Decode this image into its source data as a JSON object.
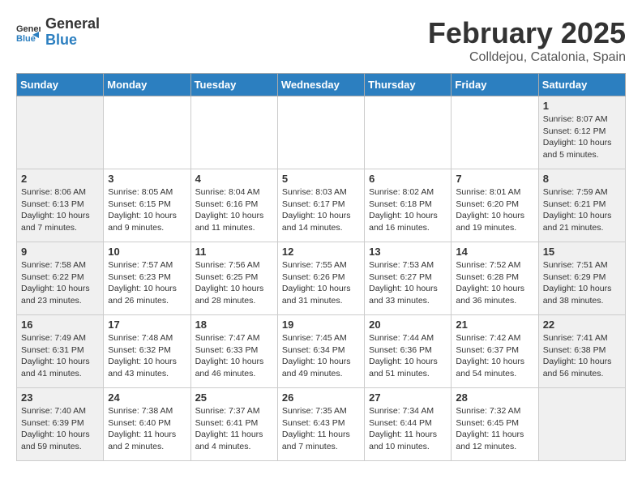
{
  "header": {
    "logo_general": "General",
    "logo_blue": "Blue",
    "month_title": "February 2025",
    "location": "Colldejou, Catalonia, Spain"
  },
  "weekdays": [
    "Sunday",
    "Monday",
    "Tuesday",
    "Wednesday",
    "Thursday",
    "Friday",
    "Saturday"
  ],
  "weeks": [
    [
      {
        "day": "",
        "info": ""
      },
      {
        "day": "",
        "info": ""
      },
      {
        "day": "",
        "info": ""
      },
      {
        "day": "",
        "info": ""
      },
      {
        "day": "",
        "info": ""
      },
      {
        "day": "",
        "info": ""
      },
      {
        "day": "1",
        "info": "Sunrise: 8:07 AM\nSunset: 6:12 PM\nDaylight: 10 hours\nand 5 minutes."
      }
    ],
    [
      {
        "day": "2",
        "info": "Sunrise: 8:06 AM\nSunset: 6:13 PM\nDaylight: 10 hours\nand 7 minutes."
      },
      {
        "day": "3",
        "info": "Sunrise: 8:05 AM\nSunset: 6:15 PM\nDaylight: 10 hours\nand 9 minutes."
      },
      {
        "day": "4",
        "info": "Sunrise: 8:04 AM\nSunset: 6:16 PM\nDaylight: 10 hours\nand 11 minutes."
      },
      {
        "day": "5",
        "info": "Sunrise: 8:03 AM\nSunset: 6:17 PM\nDaylight: 10 hours\nand 14 minutes."
      },
      {
        "day": "6",
        "info": "Sunrise: 8:02 AM\nSunset: 6:18 PM\nDaylight: 10 hours\nand 16 minutes."
      },
      {
        "day": "7",
        "info": "Sunrise: 8:01 AM\nSunset: 6:20 PM\nDaylight: 10 hours\nand 19 minutes."
      },
      {
        "day": "8",
        "info": "Sunrise: 7:59 AM\nSunset: 6:21 PM\nDaylight: 10 hours\nand 21 minutes."
      }
    ],
    [
      {
        "day": "9",
        "info": "Sunrise: 7:58 AM\nSunset: 6:22 PM\nDaylight: 10 hours\nand 23 minutes."
      },
      {
        "day": "10",
        "info": "Sunrise: 7:57 AM\nSunset: 6:23 PM\nDaylight: 10 hours\nand 26 minutes."
      },
      {
        "day": "11",
        "info": "Sunrise: 7:56 AM\nSunset: 6:25 PM\nDaylight: 10 hours\nand 28 minutes."
      },
      {
        "day": "12",
        "info": "Sunrise: 7:55 AM\nSunset: 6:26 PM\nDaylight: 10 hours\nand 31 minutes."
      },
      {
        "day": "13",
        "info": "Sunrise: 7:53 AM\nSunset: 6:27 PM\nDaylight: 10 hours\nand 33 minutes."
      },
      {
        "day": "14",
        "info": "Sunrise: 7:52 AM\nSunset: 6:28 PM\nDaylight: 10 hours\nand 36 minutes."
      },
      {
        "day": "15",
        "info": "Sunrise: 7:51 AM\nSunset: 6:29 PM\nDaylight: 10 hours\nand 38 minutes."
      }
    ],
    [
      {
        "day": "16",
        "info": "Sunrise: 7:49 AM\nSunset: 6:31 PM\nDaylight: 10 hours\nand 41 minutes."
      },
      {
        "day": "17",
        "info": "Sunrise: 7:48 AM\nSunset: 6:32 PM\nDaylight: 10 hours\nand 43 minutes."
      },
      {
        "day": "18",
        "info": "Sunrise: 7:47 AM\nSunset: 6:33 PM\nDaylight: 10 hours\nand 46 minutes."
      },
      {
        "day": "19",
        "info": "Sunrise: 7:45 AM\nSunset: 6:34 PM\nDaylight: 10 hours\nand 49 minutes."
      },
      {
        "day": "20",
        "info": "Sunrise: 7:44 AM\nSunset: 6:36 PM\nDaylight: 10 hours\nand 51 minutes."
      },
      {
        "day": "21",
        "info": "Sunrise: 7:42 AM\nSunset: 6:37 PM\nDaylight: 10 hours\nand 54 minutes."
      },
      {
        "day": "22",
        "info": "Sunrise: 7:41 AM\nSunset: 6:38 PM\nDaylight: 10 hours\nand 56 minutes."
      }
    ],
    [
      {
        "day": "23",
        "info": "Sunrise: 7:40 AM\nSunset: 6:39 PM\nDaylight: 10 hours\nand 59 minutes."
      },
      {
        "day": "24",
        "info": "Sunrise: 7:38 AM\nSunset: 6:40 PM\nDaylight: 11 hours\nand 2 minutes."
      },
      {
        "day": "25",
        "info": "Sunrise: 7:37 AM\nSunset: 6:41 PM\nDaylight: 11 hours\nand 4 minutes."
      },
      {
        "day": "26",
        "info": "Sunrise: 7:35 AM\nSunset: 6:43 PM\nDaylight: 11 hours\nand 7 minutes."
      },
      {
        "day": "27",
        "info": "Sunrise: 7:34 AM\nSunset: 6:44 PM\nDaylight: 11 hours\nand 10 minutes."
      },
      {
        "day": "28",
        "info": "Sunrise: 7:32 AM\nSunset: 6:45 PM\nDaylight: 11 hours\nand 12 minutes."
      },
      {
        "day": "",
        "info": ""
      }
    ]
  ]
}
